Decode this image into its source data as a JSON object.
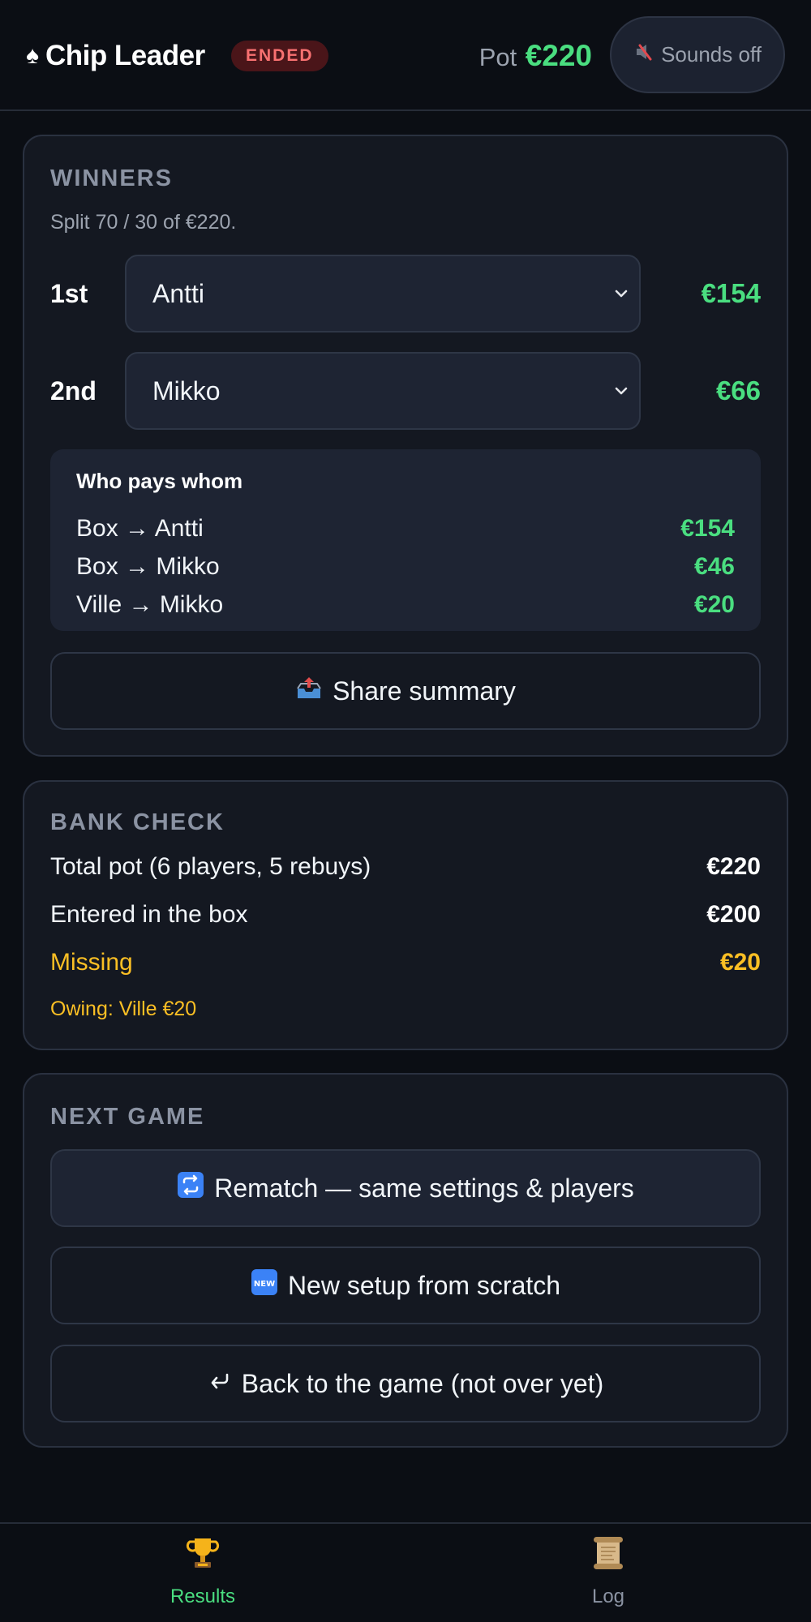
{
  "header": {
    "app_title": "Chip Leader",
    "status_badge": "ENDED",
    "pot_label": "Pot",
    "pot_amount": "€220",
    "sound_toggle_label": "Sounds off"
  },
  "winners": {
    "heading": "WINNERS",
    "split_note": "Split 70 / 30 of €220.",
    "places": [
      {
        "label": "1st",
        "player": "Antti",
        "amount": "€154"
      },
      {
        "label": "2nd",
        "player": "Mikko",
        "amount": "€66"
      }
    ],
    "payments": {
      "title": "Who pays whom",
      "rows": [
        {
          "text": "Box → Antti",
          "amount": "€154"
        },
        {
          "text": "Box → Mikko",
          "amount": "€46"
        },
        {
          "text": "Ville → Mikko",
          "amount": "€20"
        }
      ]
    },
    "share_button": "Share summary"
  },
  "bank_check": {
    "heading": "BANK CHECK",
    "rows": [
      {
        "label": "Total pot (6 players, 5 rebuys)",
        "value": "€220"
      },
      {
        "label": "Entered in the box",
        "value": "€200"
      },
      {
        "label": "Missing",
        "value": "€20"
      }
    ],
    "owing_note": "Owing: Ville €20"
  },
  "next_game": {
    "heading": "NEXT GAME",
    "rematch_button": "Rematch — same settings & players",
    "new_setup_button": "New setup from scratch",
    "back_button": "Back to the game (not over yet)"
  },
  "bottom_nav": {
    "items": [
      {
        "label": "Results",
        "icon": "trophy-icon",
        "active": true
      },
      {
        "label": "Log",
        "icon": "scroll-icon",
        "active": false
      }
    ]
  },
  "colors": {
    "accent_green": "#4ade80",
    "warning_amber": "#fbbf24",
    "ended_red": "#f87171",
    "background": "#0b0e14",
    "card": "#141821"
  }
}
